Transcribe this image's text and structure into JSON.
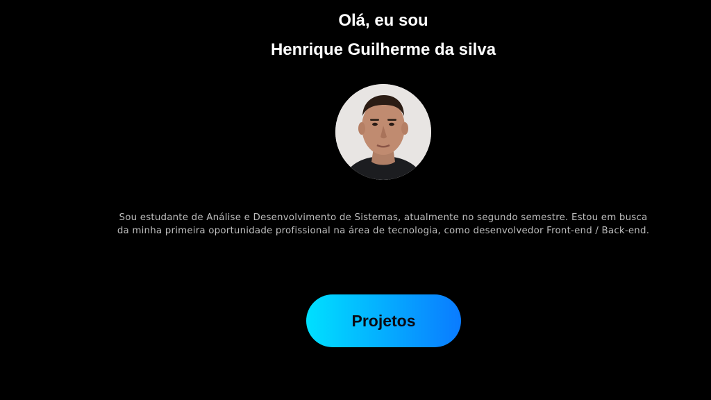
{
  "hero": {
    "greeting": "Olá, eu sou",
    "name": "Henrique Guilherme da silva",
    "avatar_icon": "profile-photo",
    "bio_line1": "Sou estudante de Análise e Desenvolvimento de Sistemas, atualmente no segundo semestre. Estou em busca",
    "bio_line2": "da minha primeira oportunidade profissional na área de tecnologia, como desenvolvedor Front-end / Back-end.",
    "cta_label": "Projetos"
  },
  "colors": {
    "background": "#000000",
    "text": "#ffffff",
    "bio_text": "#bdbdbd",
    "button_gradient_start": "#00e0ff",
    "button_gradient_end": "#0a7bff"
  }
}
